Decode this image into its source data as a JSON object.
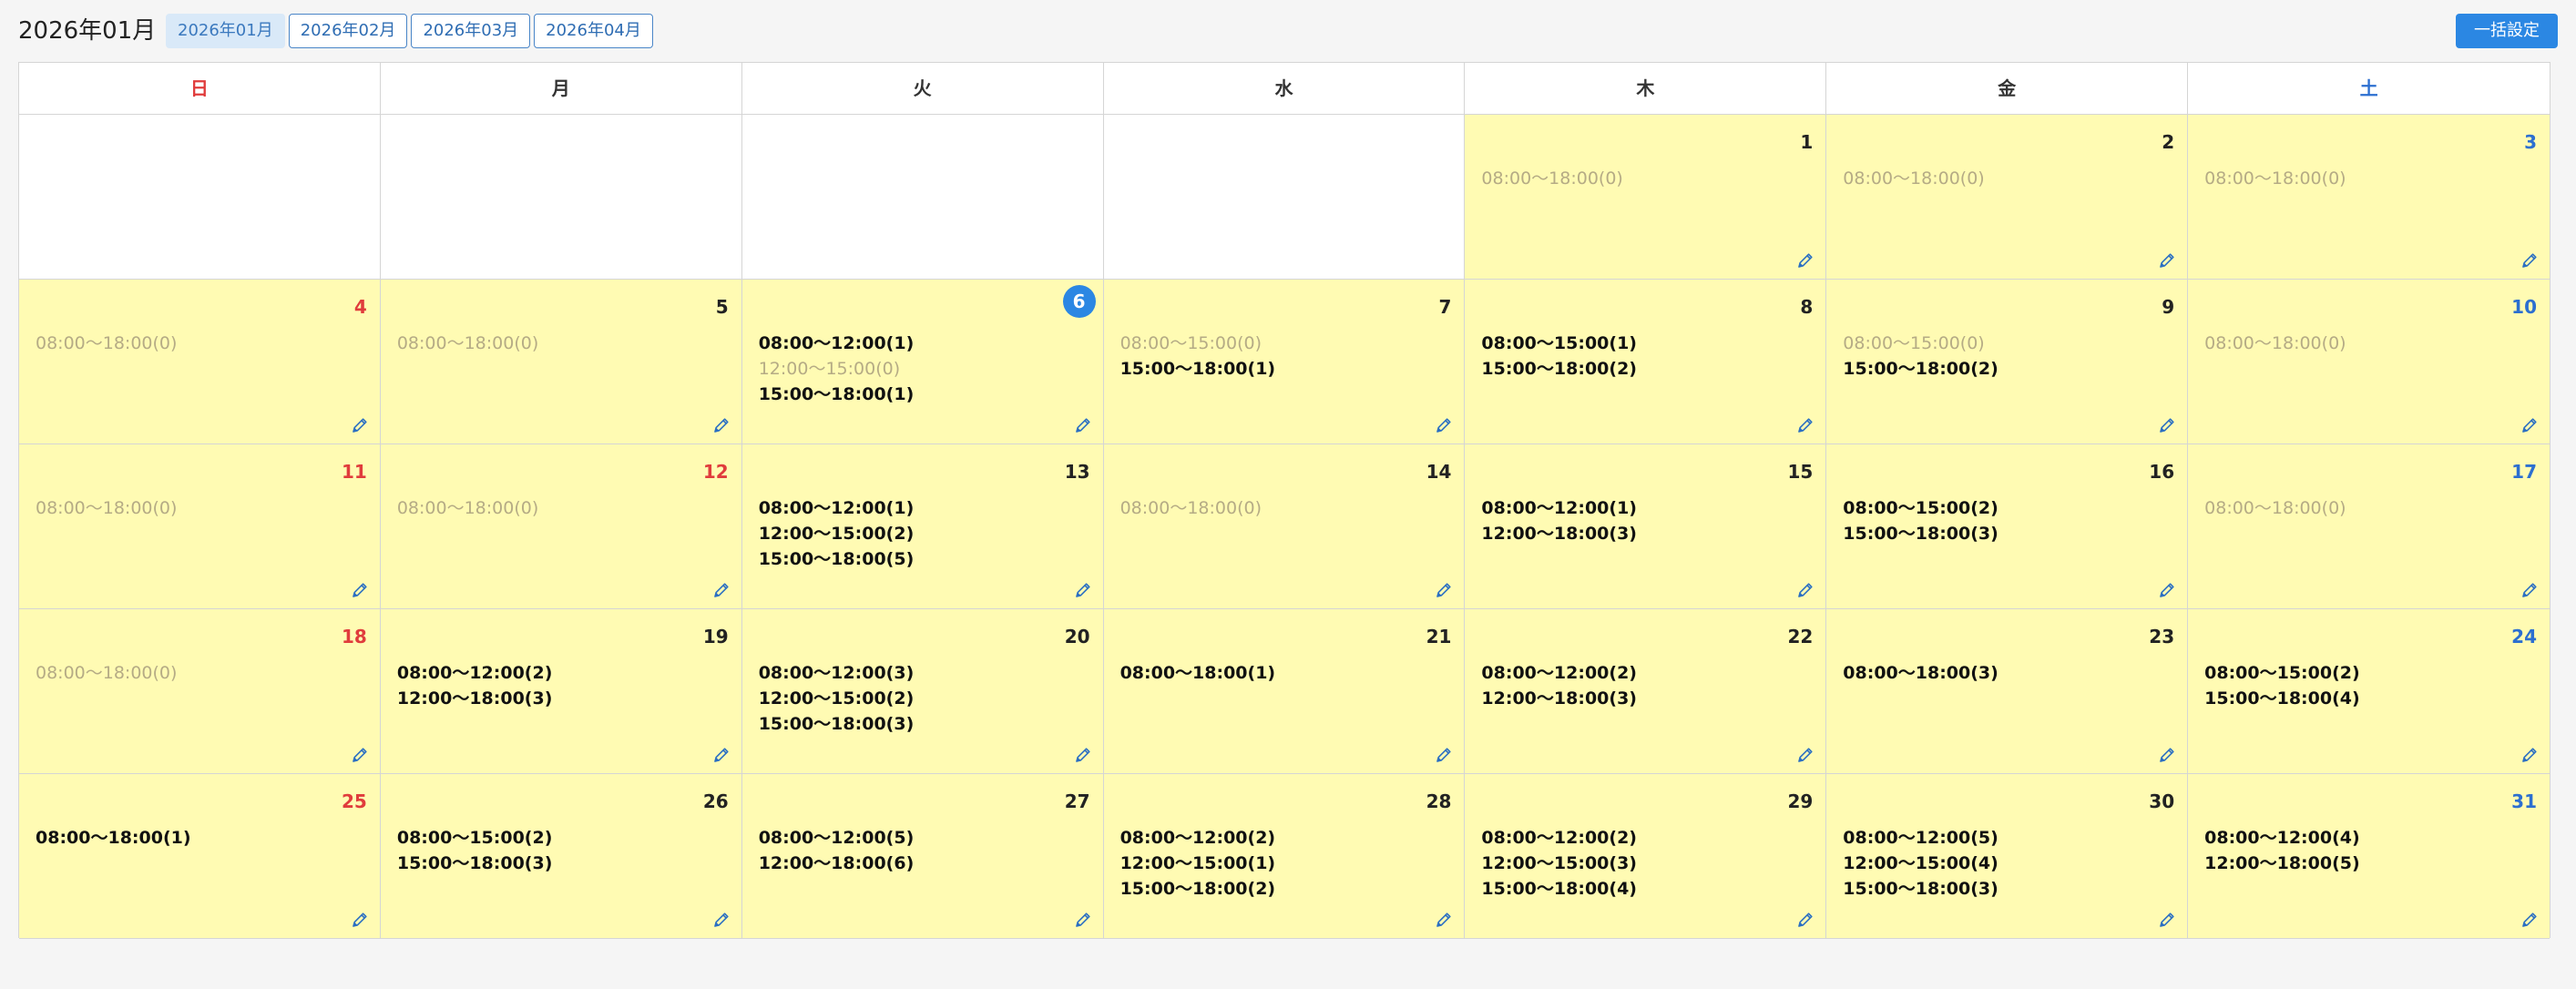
{
  "header": {
    "title": "2026年01月",
    "month_tabs": [
      "2026年01月",
      "2026年02月",
      "2026年03月",
      "2026年04月"
    ],
    "active_tab": 0,
    "bulk_button": "一括設定"
  },
  "colors": {
    "accent": "#2b87e3",
    "sunday": "#e03c3c",
    "saturday": "#2c6fd0",
    "filled_day": "#fffbb3"
  },
  "weekdays": [
    "日",
    "月",
    "火",
    "水",
    "木",
    "金",
    "土"
  ],
  "leading_blanks": 4,
  "today": 6,
  "days": [
    {
      "day": "1",
      "slots": [
        {
          "text": "08:00〜18:00(0)",
          "zero": true
        }
      ]
    },
    {
      "day": "2",
      "slots": [
        {
          "text": "08:00〜18:00(0)",
          "zero": true
        }
      ]
    },
    {
      "day": "3",
      "slots": [
        {
          "text": "08:00〜18:00(0)",
          "zero": true
        }
      ]
    },
    {
      "day": "4",
      "slots": [
        {
          "text": "08:00〜18:00(0)",
          "zero": true
        }
      ]
    },
    {
      "day": "5",
      "slots": [
        {
          "text": "08:00〜18:00(0)",
          "zero": true
        }
      ]
    },
    {
      "day": "6",
      "slots": [
        {
          "text": "08:00〜12:00(1)",
          "zero": false
        },
        {
          "text": "12:00〜15:00(0)",
          "zero": true
        },
        {
          "text": "15:00〜18:00(1)",
          "zero": false
        }
      ]
    },
    {
      "day": "7",
      "slots": [
        {
          "text": "08:00〜15:00(0)",
          "zero": true
        },
        {
          "text": "15:00〜18:00(1)",
          "zero": false
        }
      ]
    },
    {
      "day": "8",
      "slots": [
        {
          "text": "08:00〜15:00(1)",
          "zero": false
        },
        {
          "text": "15:00〜18:00(2)",
          "zero": false
        }
      ]
    },
    {
      "day": "9",
      "slots": [
        {
          "text": "08:00〜15:00(0)",
          "zero": true
        },
        {
          "text": "15:00〜18:00(2)",
          "zero": false
        }
      ]
    },
    {
      "day": "10",
      "slots": [
        {
          "text": "08:00〜18:00(0)",
          "zero": true
        }
      ]
    },
    {
      "day": "11",
      "slots": [
        {
          "text": "08:00〜18:00(0)",
          "zero": true
        }
      ]
    },
    {
      "day": "12",
      "holiday": true,
      "slots": [
        {
          "text": "08:00〜18:00(0)",
          "zero": true
        }
      ]
    },
    {
      "day": "13",
      "slots": [
        {
          "text": "08:00〜12:00(1)",
          "zero": false
        },
        {
          "text": "12:00〜15:00(2)",
          "zero": false
        },
        {
          "text": "15:00〜18:00(5)",
          "zero": false
        }
      ]
    },
    {
      "day": "14",
      "slots": [
        {
          "text": "08:00〜18:00(0)",
          "zero": true
        }
      ]
    },
    {
      "day": "15",
      "slots": [
        {
          "text": "08:00〜12:00(1)",
          "zero": false
        },
        {
          "text": "12:00〜18:00(3)",
          "zero": false
        }
      ]
    },
    {
      "day": "16",
      "slots": [
        {
          "text": "08:00〜15:00(2)",
          "zero": false
        },
        {
          "text": "15:00〜18:00(3)",
          "zero": false
        }
      ]
    },
    {
      "day": "17",
      "slots": [
        {
          "text": "08:00〜18:00(0)",
          "zero": true
        }
      ]
    },
    {
      "day": "18",
      "slots": [
        {
          "text": "08:00〜18:00(0)",
          "zero": true
        }
      ]
    },
    {
      "day": "19",
      "slots": [
        {
          "text": "08:00〜12:00(2)",
          "zero": false
        },
        {
          "text": "12:00〜18:00(3)",
          "zero": false
        }
      ]
    },
    {
      "day": "20",
      "slots": [
        {
          "text": "08:00〜12:00(3)",
          "zero": false
        },
        {
          "text": "12:00〜15:00(2)",
          "zero": false
        },
        {
          "text": "15:00〜18:00(3)",
          "zero": false
        }
      ]
    },
    {
      "day": "21",
      "slots": [
        {
          "text": "08:00〜18:00(1)",
          "zero": false
        }
      ]
    },
    {
      "day": "22",
      "slots": [
        {
          "text": "08:00〜12:00(2)",
          "zero": false
        },
        {
          "text": "12:00〜18:00(3)",
          "zero": false
        }
      ]
    },
    {
      "day": "23",
      "slots": [
        {
          "text": "08:00〜18:00(3)",
          "zero": false
        }
      ]
    },
    {
      "day": "24",
      "slots": [
        {
          "text": "08:00〜15:00(2)",
          "zero": false
        },
        {
          "text": "15:00〜18:00(4)",
          "zero": false
        }
      ]
    },
    {
      "day": "25",
      "slots": [
        {
          "text": "08:00〜18:00(1)",
          "zero": false
        }
      ]
    },
    {
      "day": "26",
      "slots": [
        {
          "text": "08:00〜15:00(2)",
          "zero": false
        },
        {
          "text": "15:00〜18:00(3)",
          "zero": false
        }
      ]
    },
    {
      "day": "27",
      "slots": [
        {
          "text": "08:00〜12:00(5)",
          "zero": false
        },
        {
          "text": "12:00〜18:00(6)",
          "zero": false
        }
      ]
    },
    {
      "day": "28",
      "slots": [
        {
          "text": "08:00〜12:00(2)",
          "zero": false
        },
        {
          "text": "12:00〜15:00(1)",
          "zero": false
        },
        {
          "text": "15:00〜18:00(2)",
          "zero": false
        }
      ]
    },
    {
      "day": "29",
      "slots": [
        {
          "text": "08:00〜12:00(2)",
          "zero": false
        },
        {
          "text": "12:00〜15:00(3)",
          "zero": false
        },
        {
          "text": "15:00〜18:00(4)",
          "zero": false
        }
      ]
    },
    {
      "day": "30",
      "slots": [
        {
          "text": "08:00〜12:00(5)",
          "zero": false
        },
        {
          "text": "12:00〜15:00(4)",
          "zero": false
        },
        {
          "text": "15:00〜18:00(3)",
          "zero": false
        }
      ]
    },
    {
      "day": "31",
      "slots": [
        {
          "text": "08:00〜12:00(4)",
          "zero": false
        },
        {
          "text": "12:00〜18:00(5)",
          "zero": false
        }
      ]
    }
  ]
}
